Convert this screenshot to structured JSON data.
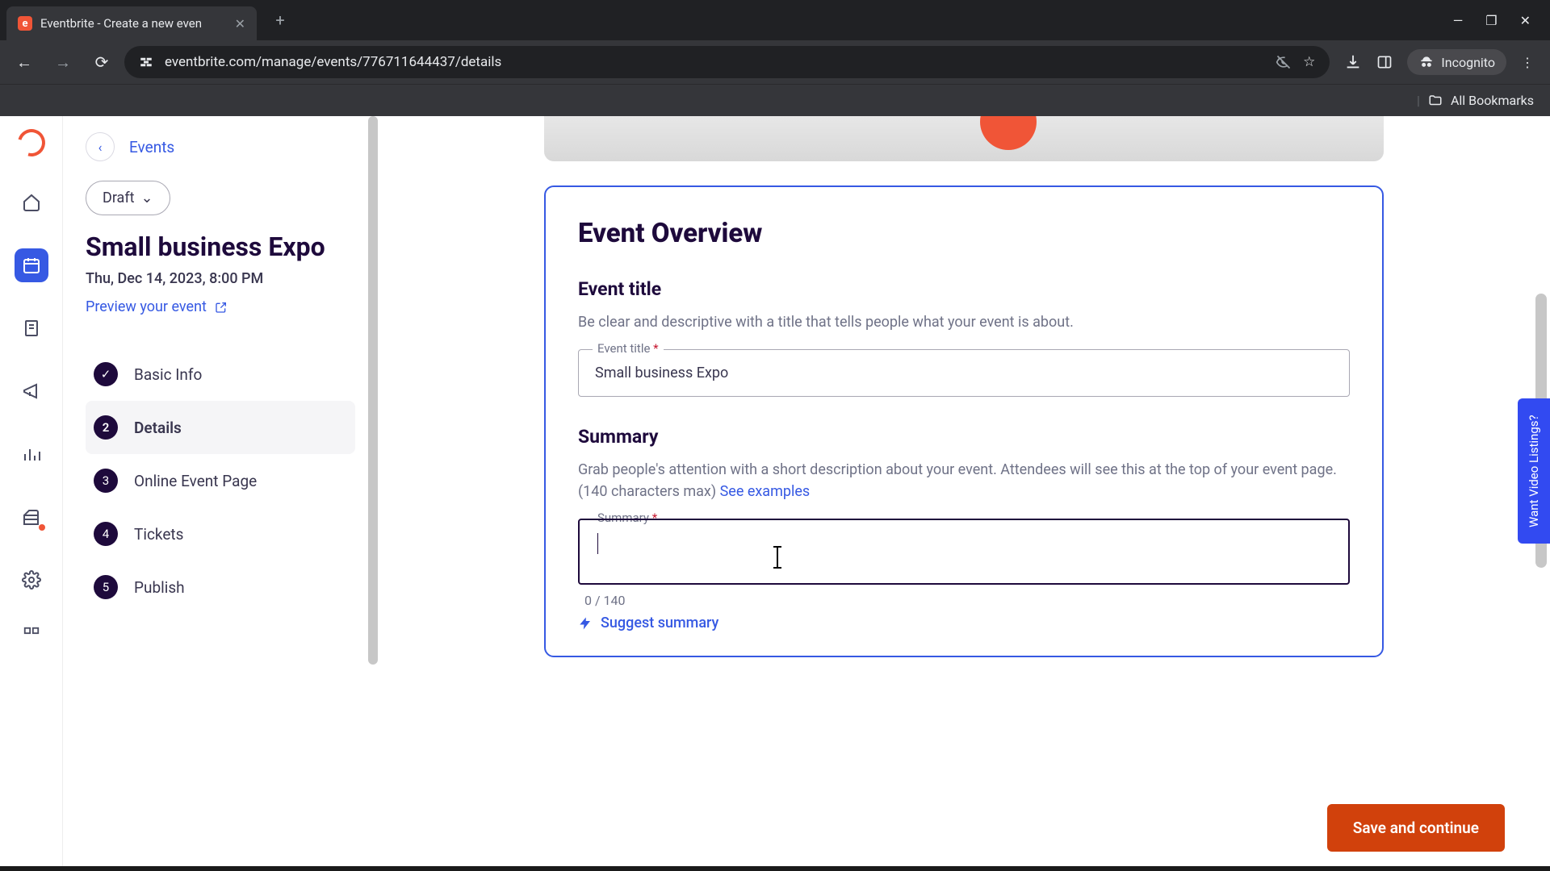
{
  "browser": {
    "tab_title": "Eventbrite - Create a new even",
    "url": "eventbrite.com/manage/events/776711644437/details",
    "incognito_label": "Incognito",
    "all_bookmarks": "All Bookmarks"
  },
  "sidebar": {
    "back_label": "Events",
    "status_label": "Draft",
    "event_title": "Small business Expo",
    "event_date": "Thu, Dec 14, 2023, 8:00 PM",
    "preview_label": "Preview your event",
    "steps": [
      {
        "num": "✓",
        "label": "Basic Info"
      },
      {
        "num": "2",
        "label": "Details"
      },
      {
        "num": "3",
        "label": "Online Event Page"
      },
      {
        "num": "4",
        "label": "Tickets"
      },
      {
        "num": "5",
        "label": "Publish"
      }
    ]
  },
  "main": {
    "card_heading": "Event Overview",
    "title_section": {
      "heading": "Event title",
      "help": "Be clear and descriptive with a title that tells people what your event is about.",
      "label": "Event title",
      "value": "Small business Expo"
    },
    "summary_section": {
      "heading": "Summary",
      "help": "Grab people's attention with a short description about your event. Attendees will see this at the top of your event page. (140 characters max) ",
      "see_examples": "See examples",
      "label": "Summary",
      "value": "",
      "char_count": "0 / 140",
      "suggest_label": "Suggest summary"
    },
    "save_label": "Save and continue",
    "video_tab": "Want Video Listings?"
  }
}
